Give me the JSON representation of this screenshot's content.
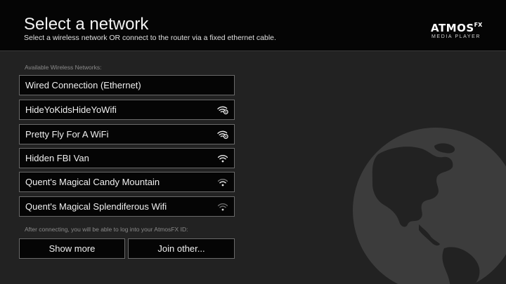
{
  "header": {
    "title": "Select a network",
    "subtitle": "Select a wireless network OR connect to the router via a fixed ethernet cable.",
    "logo_main": "ATMOS",
    "logo_super": "FX",
    "logo_sub": "MEDIA PLAYER"
  },
  "networks": {
    "section_label": "Available Wireless Networks:",
    "items": [
      {
        "label": "Wired Connection (Ethernet)",
        "icon": "none"
      },
      {
        "label": "HideYoKidsHideYoWifi",
        "icon": "wifi-locked-icon"
      },
      {
        "label": "Pretty Fly For A WiFi",
        "icon": "wifi-locked-icon"
      },
      {
        "label": "Hidden FBI Van",
        "icon": "wifi-icon"
      },
      {
        "label": "Quent's Magical Candy Mountain",
        "icon": "wifi-icon"
      },
      {
        "label": "Quent's Magical Splendiferous Wifi",
        "icon": "wifi-weak-icon"
      }
    ]
  },
  "footer": {
    "note": "After connecting, you will be able to log into your AtmosFX ID:",
    "show_more_label": "Show more",
    "join_other_label": "Join other..."
  },
  "colors": {
    "background": "#222222",
    "header_background": "#050505",
    "item_border": "#6a6a6a",
    "globe": "#3c3c3c"
  }
}
